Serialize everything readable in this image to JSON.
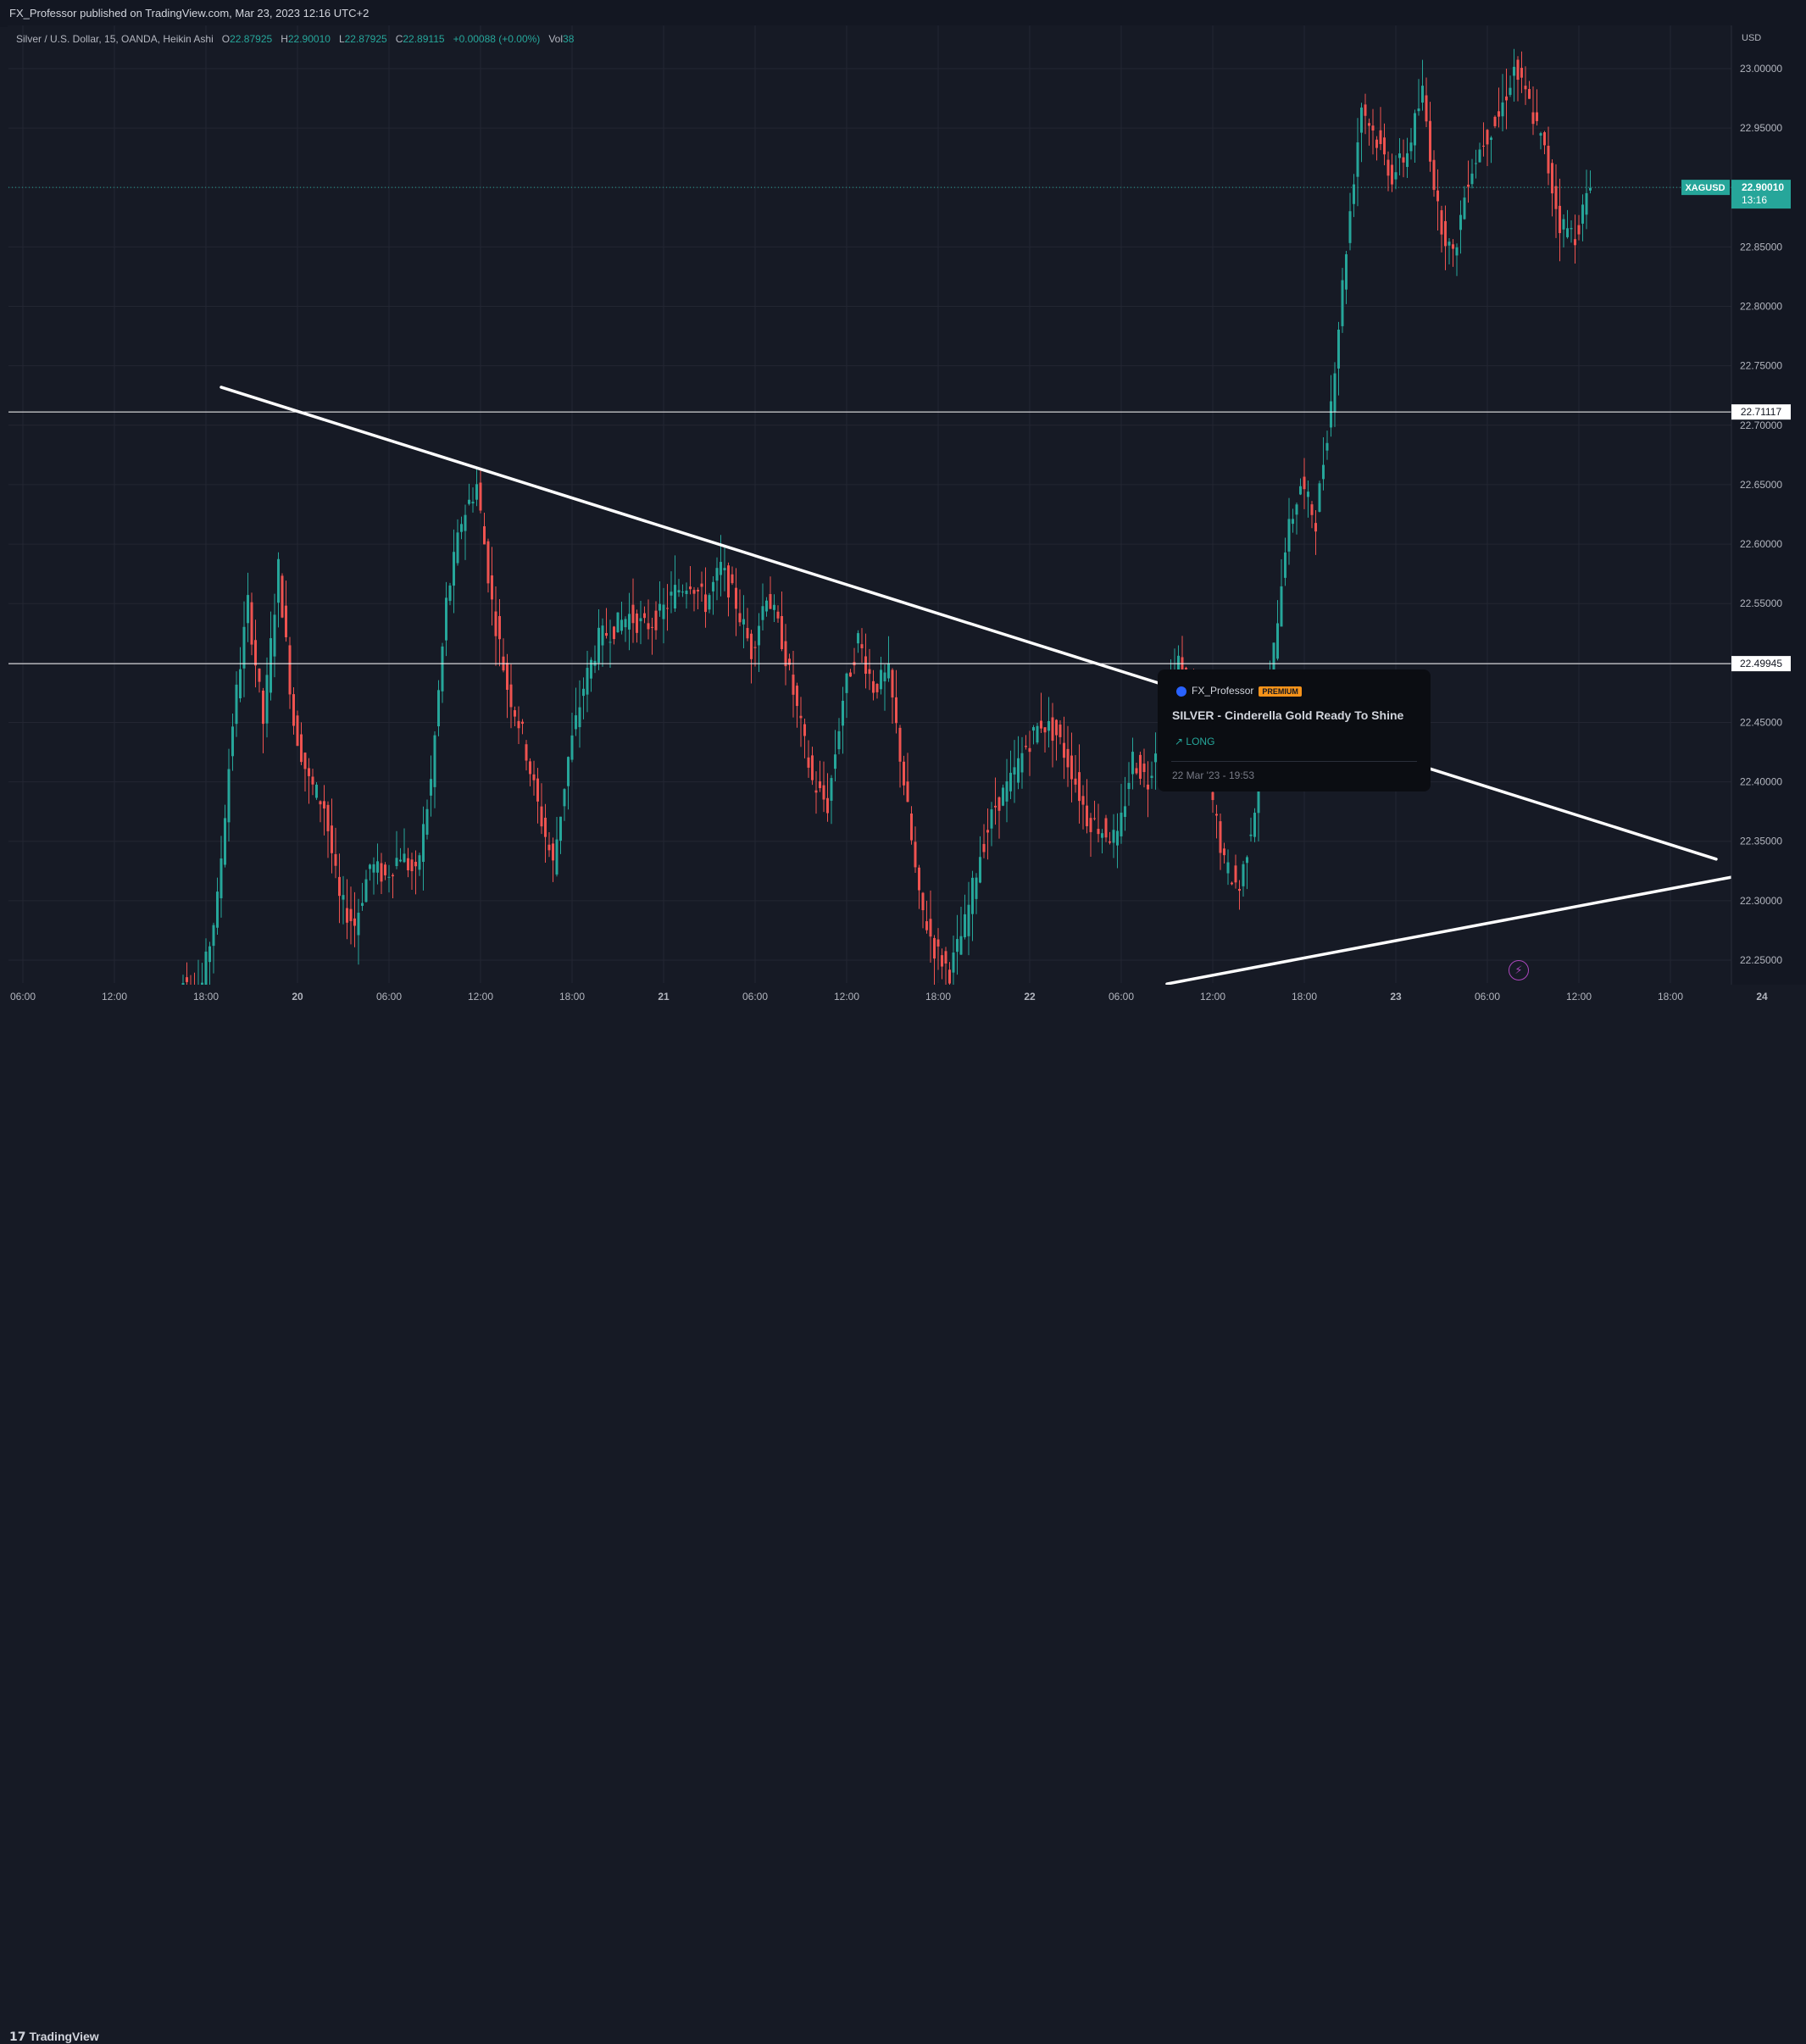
{
  "header": {
    "published": "FX_Professor published on TradingView.com, Mar 23, 2023 12:16 UTC+2"
  },
  "symbol": {
    "name": "Silver / U.S. Dollar, 15, OANDA, Heikin Ashi",
    "o_label": "O",
    "o_value": "22.87925",
    "h_label": "H",
    "h_value": "22.90010",
    "l_label": "L",
    "l_value": "22.87925",
    "c_label": "C",
    "c_value": "22.89115",
    "change": "+0.00088 (+0.00%)",
    "vol_label": "Vol",
    "vol_value": "38"
  },
  "colors": {
    "up": "#26a69a",
    "down": "#ef5350",
    "bg": "#161a25",
    "grid": "#232632",
    "line": "#ffffff"
  },
  "chart_data": {
    "type": "candlestick",
    "currency": "USD",
    "y_ticks": [
      "23.00000",
      "22.95000",
      "22.90000",
      "22.85000",
      "22.80000",
      "22.75000",
      "22.70000",
      "22.65000",
      "22.60000",
      "22.55000",
      "22.50000",
      "22.45000",
      "22.40000",
      "22.35000",
      "22.30000",
      "22.25000"
    ],
    "ylim": [
      22.23,
      23.04
    ],
    "x_ticks": [
      "06:00",
      "12:00",
      "18:00",
      "20",
      "06:00",
      "12:00",
      "18:00",
      "21",
      "06:00",
      "12:00",
      "18:00",
      "22",
      "06:00",
      "12:00",
      "18:00",
      "23",
      "06:00",
      "12:00",
      "18:00",
      "24"
    ],
    "current_price": {
      "symbol": "XAGUSD",
      "price": "22.90010",
      "countdown": "13:16",
      "value": 22.9001
    },
    "horizontal_lines": [
      {
        "label": "22.71117",
        "value": 22.71117
      },
      {
        "label": "22.49945",
        "value": 22.49945
      }
    ],
    "trendlines": [
      {
        "name": "descending resistance",
        "from": [
          "Mar 19 19:00",
          22.732
        ],
        "to": [
          "Mar 23 21:00",
          22.335
        ]
      },
      {
        "name": "ascending support",
        "from": [
          "Mar 22 09:00",
          22.23
        ],
        "to": [
          "Mar 23 22:30",
          22.321
        ]
      }
    ],
    "candles_hourly_close": [
      {
        "t": "Mar 19 16:00",
        "o": 22.21,
        "c": 22.24
      },
      {
        "t": "Mar 19 17:00",
        "o": 22.22,
        "c": 22.23
      },
      {
        "t": "Mar 19 18:00",
        "o": 22.23,
        "c": 22.3
      },
      {
        "t": "Mar 19 19:00",
        "o": 22.3,
        "c": 22.45
      },
      {
        "t": "Mar 19 20:00",
        "o": 22.45,
        "c": 22.55
      },
      {
        "t": "Mar 19 21:00",
        "o": 22.55,
        "c": 22.45
      },
      {
        "t": "Mar 19 22:00",
        "o": 22.45,
        "c": 22.58
      },
      {
        "t": "Mar 19 23:00",
        "o": 22.58,
        "c": 22.45
      },
      {
        "t": "Mar 20 00:00",
        "o": 22.45,
        "c": 22.4
      },
      {
        "t": "Mar 20 01:00",
        "o": 22.4,
        "c": 22.38
      },
      {
        "t": "Mar 20 02:00",
        "o": 22.38,
        "c": 22.3
      },
      {
        "t": "Mar 20 03:00",
        "o": 22.3,
        "c": 22.28
      },
      {
        "t": "Mar 20 04:00",
        "o": 22.28,
        "c": 22.33
      },
      {
        "t": "Mar 20 05:00",
        "o": 22.33,
        "c": 22.32
      },
      {
        "t": "Mar 20 06:00",
        "o": 22.32,
        "c": 22.34
      },
      {
        "t": "Mar 20 07:00",
        "o": 22.34,
        "c": 22.32
      },
      {
        "t": "Mar 20 08:00",
        "o": 22.32,
        "c": 22.4
      },
      {
        "t": "Mar 20 09:00",
        "o": 22.4,
        "c": 22.55
      },
      {
        "t": "Mar 20 10:00",
        "o": 22.55,
        "c": 22.62
      },
      {
        "t": "Mar 20 11:00",
        "o": 22.62,
        "c": 22.65
      },
      {
        "t": "Mar 20 12:00",
        "o": 22.65,
        "c": 22.55
      },
      {
        "t": "Mar 20 13:00",
        "o": 22.55,
        "c": 22.48
      },
      {
        "t": "Mar 20 14:00",
        "o": 22.48,
        "c": 22.44
      },
      {
        "t": "Mar 20 15:00",
        "o": 22.44,
        "c": 22.38
      },
      {
        "t": "Mar 20 16:00",
        "o": 22.38,
        "c": 22.33
      },
      {
        "t": "Mar 20 17:00",
        "o": 22.33,
        "c": 22.42
      },
      {
        "t": "Mar 20 18:00",
        "o": 22.42,
        "c": 22.48
      },
      {
        "t": "Mar 20 19:00",
        "o": 22.48,
        "c": 22.52
      },
      {
        "t": "Mar 20 20:00",
        "o": 22.52,
        "c": 22.53
      },
      {
        "t": "Mar 20 21:00",
        "o": 22.53,
        "c": 22.54
      },
      {
        "t": "Mar 20 22:00",
        "o": 22.54,
        "c": 22.53
      },
      {
        "t": "Mar 20 23:00",
        "o": 22.53,
        "c": 22.54
      },
      {
        "t": "Mar 21 00:00",
        "o": 22.54,
        "c": 22.56
      },
      {
        "t": "Mar 21 01:00",
        "o": 22.56,
        "c": 22.57
      },
      {
        "t": "Mar 21 02:00",
        "o": 22.57,
        "c": 22.55
      },
      {
        "t": "Mar 21 03:00",
        "o": 22.55,
        "c": 22.58
      },
      {
        "t": "Mar 21 04:00",
        "o": 22.58,
        "c": 22.55
      },
      {
        "t": "Mar 21 05:00",
        "o": 22.55,
        "c": 22.51
      },
      {
        "t": "Mar 21 06:00",
        "o": 22.51,
        "c": 22.56
      },
      {
        "t": "Mar 21 07:00",
        "o": 22.56,
        "c": 22.52
      },
      {
        "t": "Mar 21 08:00",
        "o": 22.52,
        "c": 22.46
      },
      {
        "t": "Mar 21 09:00",
        "o": 22.46,
        "c": 22.4
      },
      {
        "t": "Mar 21 10:00",
        "o": 22.4,
        "c": 22.38
      },
      {
        "t": "Mar 21 11:00",
        "o": 22.38,
        "c": 22.47
      },
      {
        "t": "Mar 21 12:00",
        "o": 22.47,
        "c": 22.52
      },
      {
        "t": "Mar 21 13:00",
        "o": 22.52,
        "c": 22.48
      },
      {
        "t": "Mar 21 14:00",
        "o": 22.48,
        "c": 22.49
      },
      {
        "t": "Mar 21 15:00",
        "o": 22.49,
        "c": 22.4
      },
      {
        "t": "Mar 21 16:00",
        "o": 22.4,
        "c": 22.3
      },
      {
        "t": "Mar 21 17:00",
        "o": 22.3,
        "c": 22.26
      },
      {
        "t": "Mar 21 18:00",
        "o": 22.26,
        "c": 22.24
      },
      {
        "t": "Mar 21 19:00",
        "o": 22.24,
        "c": 22.28
      },
      {
        "t": "Mar 21 20:00",
        "o": 22.28,
        "c": 22.34
      },
      {
        "t": "Mar 21 21:00",
        "o": 22.34,
        "c": 22.38
      },
      {
        "t": "Mar 21 22:00",
        "o": 22.38,
        "c": 22.4
      },
      {
        "t": "Mar 21 23:00",
        "o": 22.4,
        "c": 22.43
      },
      {
        "t": "Mar 22 00:00",
        "o": 22.43,
        "c": 22.45
      },
      {
        "t": "Mar 22 01:00",
        "o": 22.45,
        "c": 22.44
      },
      {
        "t": "Mar 22 02:00",
        "o": 22.44,
        "c": 22.41
      },
      {
        "t": "Mar 22 03:00",
        "o": 22.41,
        "c": 22.37
      },
      {
        "t": "Mar 22 04:00",
        "o": 22.37,
        "c": 22.36
      },
      {
        "t": "Mar 22 05:00",
        "o": 22.36,
        "c": 22.35
      },
      {
        "t": "Mar 22 06:00",
        "o": 22.35,
        "c": 22.42
      },
      {
        "t": "Mar 22 07:00",
        "o": 22.42,
        "c": 22.4
      },
      {
        "t": "Mar 22 08:00",
        "o": 22.4,
        "c": 22.46
      },
      {
        "t": "Mar 22 09:00",
        "o": 22.46,
        "c": 22.5
      },
      {
        "t": "Mar 22 10:00",
        "o": 22.5,
        "c": 22.46
      },
      {
        "t": "Mar 22 11:00",
        "o": 22.46,
        "c": 22.4
      },
      {
        "t": "Mar 22 12:00",
        "o": 22.4,
        "c": 22.33
      },
      {
        "t": "Mar 22 13:00",
        "o": 22.33,
        "c": 22.31
      },
      {
        "t": "Mar 22 14:00",
        "o": 22.31,
        "c": 22.38
      },
      {
        "t": "Mar 22 15:00",
        "o": 22.38,
        "c": 22.48
      },
      {
        "t": "Mar 22 16:00",
        "o": 22.48,
        "c": 22.6
      },
      {
        "t": "Mar 22 17:00",
        "o": 22.6,
        "c": 22.65
      },
      {
        "t": "Mar 22 18:00",
        "o": 22.65,
        "c": 22.62
      },
      {
        "t": "Mar 22 19:00",
        "o": 22.62,
        "c": 22.72
      },
      {
        "t": "Mar 22 20:00",
        "o": 22.72,
        "c": 22.85
      },
      {
        "t": "Mar 22 21:00",
        "o": 22.85,
        "c": 22.97
      },
      {
        "t": "Mar 22 22:00",
        "o": 22.97,
        "c": 22.94
      },
      {
        "t": "Mar 22 23:00",
        "o": 22.94,
        "c": 22.91
      },
      {
        "t": "Mar 23 00:00",
        "o": 22.91,
        "c": 22.93
      },
      {
        "t": "Mar 23 01:00",
        "o": 22.93,
        "c": 22.98
      },
      {
        "t": "Mar 23 02:00",
        "o": 22.98,
        "c": 22.88
      },
      {
        "t": "Mar 23 03:00",
        "o": 22.88,
        "c": 22.84
      },
      {
        "t": "Mar 23 04:00",
        "o": 22.84,
        "c": 22.91
      },
      {
        "t": "Mar 23 05:00",
        "o": 22.91,
        "c": 22.94
      },
      {
        "t": "Mar 23 06:00",
        "o": 22.94,
        "c": 22.96
      },
      {
        "t": "Mar 23 07:00",
        "o": 22.96,
        "c": 23.0
      },
      {
        "t": "Mar 23 08:00",
        "o": 23.0,
        "c": 22.97
      },
      {
        "t": "Mar 23 09:00",
        "o": 22.97,
        "c": 22.93
      },
      {
        "t": "Mar 23 10:00",
        "o": 22.93,
        "c": 22.87
      },
      {
        "t": "Mar 23 11:00",
        "o": 22.87,
        "c": 22.86
      },
      {
        "t": "Mar 23 12:00",
        "o": 22.86,
        "c": 22.9
      }
    ]
  },
  "idea": {
    "author": "FX_Professor",
    "badge": "PREMIUM",
    "title": "SILVER - Cinderella Gold Ready To Shine",
    "direction": "LONG",
    "date": "22 Mar '23 - 19:53"
  },
  "footer": {
    "brand": "TradingView"
  }
}
